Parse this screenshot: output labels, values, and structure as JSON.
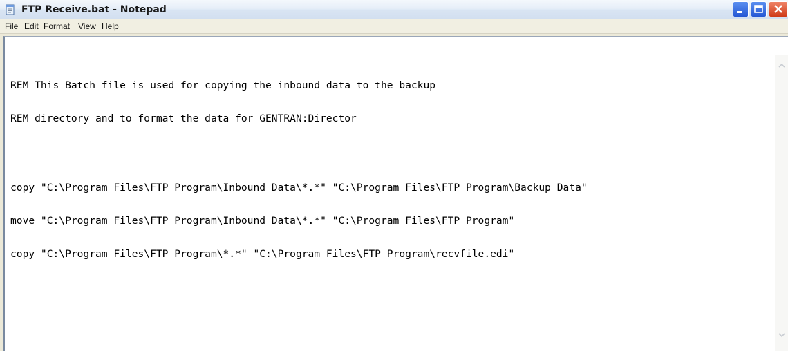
{
  "window": {
    "title": "FTP Receive.bat - Notepad",
    "app_icon": "notepad-icon",
    "controls": [
      "minimize-icon",
      "maximize-icon",
      "close-icon"
    ]
  },
  "menu": {
    "file": "File",
    "edit": "Edit",
    "format": "Format",
    "view": "View",
    "help": "Help"
  },
  "document": {
    "lines": [
      "REM This Batch file is used for copying the inbound data to the backup",
      "REM directory and to format the data for GENTRAN:Director",
      "",
      "copy \"C:\\Program Files\\FTP Program\\Inbound Data\\*.*\" \"C:\\Program Files\\FTP Program\\Backup Data\"",
      "move \"C:\\Program Files\\FTP Program\\Inbound Data\\*.*\" \"C:\\Program Files\\FTP Program\"",
      "copy \"C:\\Program Files\\FTP Program\\*.*\" \"C:\\Program Files\\FTP Program\\recvfile.edi\""
    ]
  },
  "colors": {
    "title_text": "#1a1a1a",
    "close_button": "#cf3a17",
    "window_buttons": "#2457d4",
    "menubar": "#f1efe2"
  }
}
